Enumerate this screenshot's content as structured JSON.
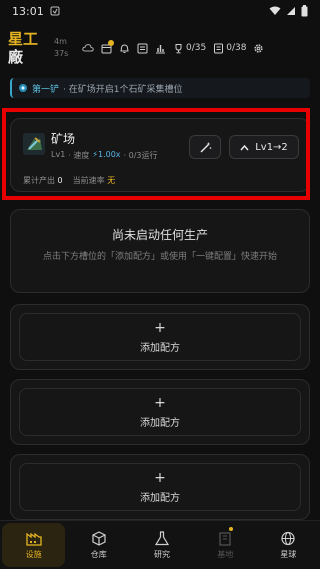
{
  "status": {
    "time": "13:01"
  },
  "header": {
    "logo_line1": "星工",
    "logo_line2": "廠",
    "timer_line1": "4m",
    "timer_line2": "37s",
    "counter1": "0/35",
    "counter2": "0/38"
  },
  "banner": {
    "tag": "第一铲",
    "text": "· 在矿场开启1个石矿采集槽位"
  },
  "facility": {
    "name": "矿场",
    "level": "Lv1",
    "speed_label": "· 速度",
    "speed_value": "⚡1.00x",
    "running": "· 0/3运行",
    "upgrade_label": "Lv1→2",
    "total_output_label": "累计产出",
    "total_output_value": "0",
    "current_rate_label": "当前速率",
    "current_rate_value": "无"
  },
  "empty_state": {
    "title": "尚未启动任何生产",
    "description": "点击下方槽位的「添加配方」或使用「一键配置」快速开始"
  },
  "slots": [
    {
      "plus": "+",
      "label": "添加配方"
    },
    {
      "plus": "+",
      "label": "添加配方"
    },
    {
      "plus": "+",
      "label": "添加配方"
    }
  ],
  "nav": [
    {
      "label": "设施",
      "icon": "factory-icon"
    },
    {
      "label": "仓库",
      "icon": "cube-icon"
    },
    {
      "label": "研究",
      "icon": "flask-icon"
    },
    {
      "label": "基地",
      "icon": "building-icon"
    },
    {
      "label": "星球",
      "icon": "globe-icon"
    }
  ],
  "colors": {
    "accent": "#e6b422",
    "highlight": "#e60000",
    "speed": "#58b6e8"
  }
}
